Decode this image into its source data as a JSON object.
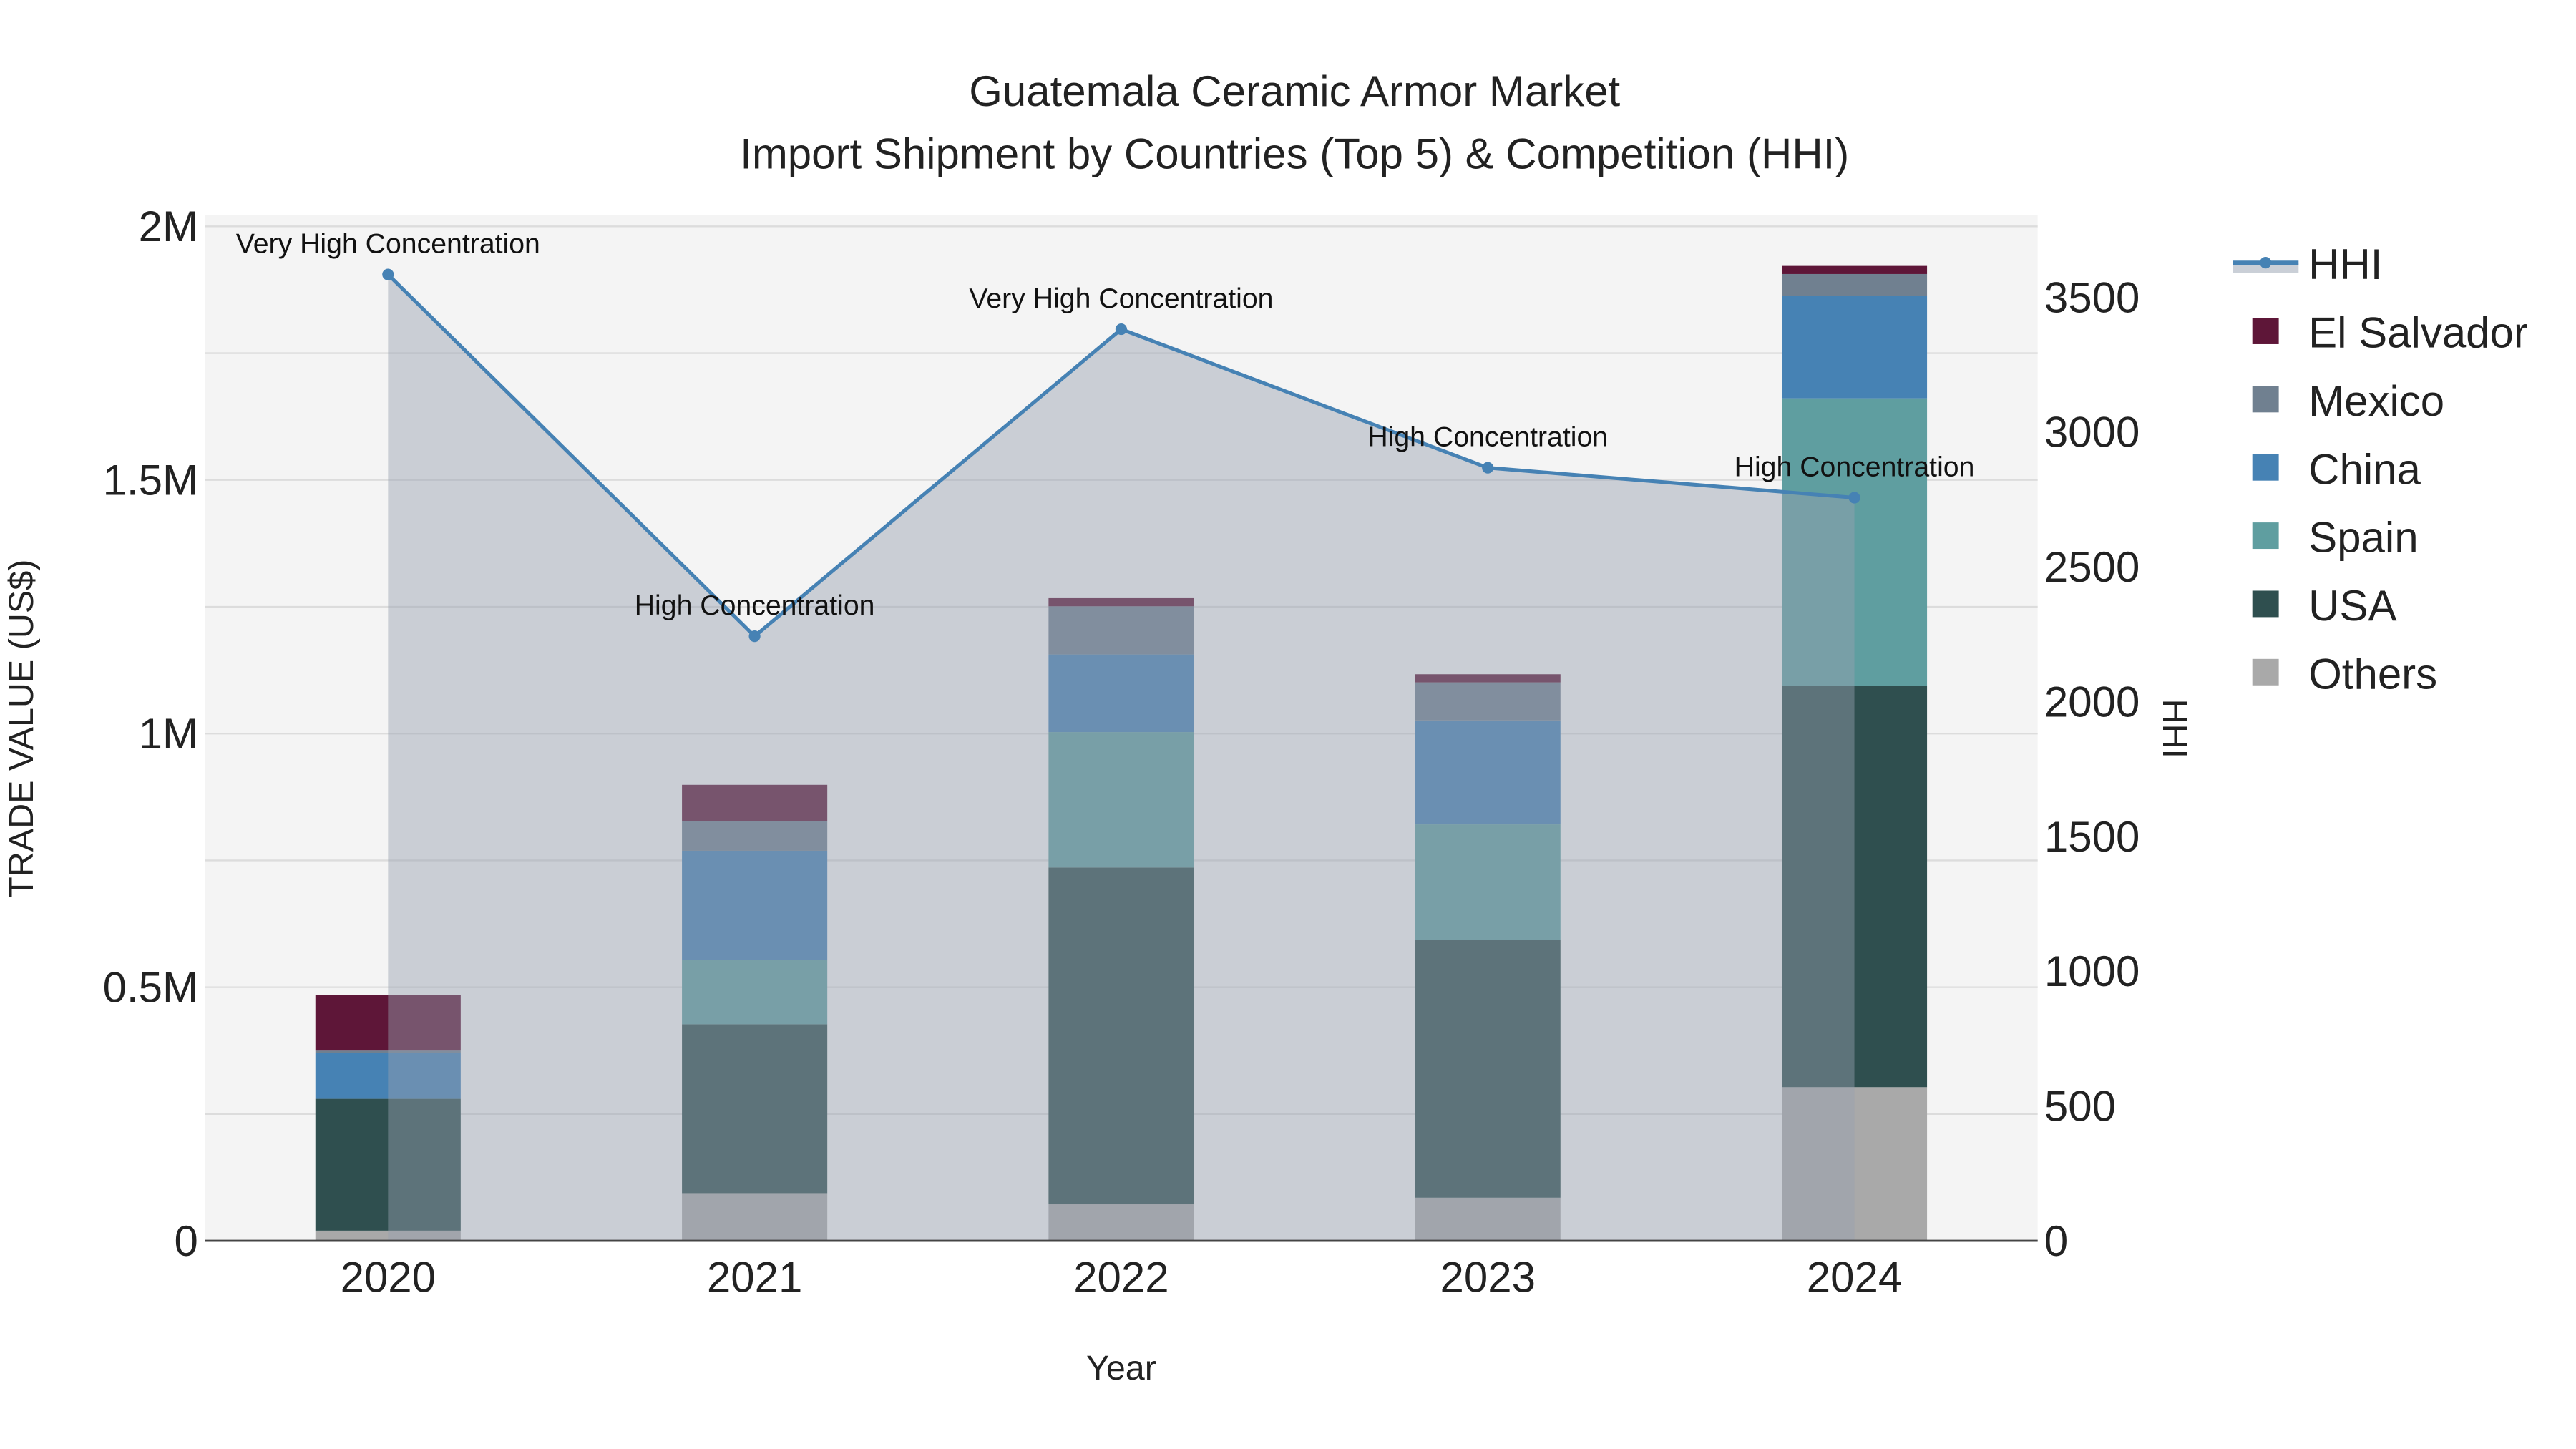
{
  "chart_data": {
    "type": "bar",
    "title": "Guatemala Ceramic Armor Market",
    "subtitle": "Import Shipment by Countries (Top 5) & Competition (HHI)",
    "xlabel": "Year",
    "ylabel": "TRADE VALUE (US$)",
    "y2label": "HHI",
    "categories": [
      "2020",
      "2021",
      "2022",
      "2023",
      "2024"
    ],
    "ylim": [
      0,
      2000000
    ],
    "y2lim": [
      0,
      3800
    ],
    "yticks": [
      {
        "v": 0,
        "label": "0"
      },
      {
        "v": 500000,
        "label": "0.5M"
      },
      {
        "v": 1000000,
        "label": "1M"
      },
      {
        "v": 1500000,
        "label": "1.5M"
      },
      {
        "v": 2000000,
        "label": "2M"
      }
    ],
    "y2ticks": [
      {
        "v": 0,
        "label": "0"
      },
      {
        "v": 500,
        "label": "500"
      },
      {
        "v": 1000,
        "label": "1000"
      },
      {
        "v": 1500,
        "label": "1500"
      },
      {
        "v": 2000,
        "label": "2000"
      },
      {
        "v": 2500,
        "label": "2500"
      },
      {
        "v": 3000,
        "label": "3000"
      },
      {
        "v": 3500,
        "label": "3500"
      }
    ],
    "stacked": true,
    "series": [
      {
        "name": "Others",
        "color": "#a9a9a9",
        "values": [
          20000,
          94000,
          72000,
          85000,
          303000
        ]
      },
      {
        "name": "USA",
        "color": "#2f4f4f",
        "values": [
          260000,
          333000,
          664000,
          508000,
          791000
        ]
      },
      {
        "name": "Spain",
        "color": "#5f9ea0",
        "values": [
          0,
          127000,
          267000,
          228000,
          567000
        ]
      },
      {
        "name": "China",
        "color": "#4682b4",
        "values": [
          90000,
          215000,
          153000,
          205000,
          202000
        ]
      },
      {
        "name": "Mexico",
        "color": "#708090",
        "values": [
          5000,
          58000,
          95000,
          75000,
          43000
        ]
      },
      {
        "name": "El Salvador",
        "color": "#5e1638",
        "values": [
          110000,
          72000,
          16000,
          16000,
          16000
        ]
      }
    ],
    "hhi": {
      "name": "HHI",
      "color": "#4682b4",
      "values": [
        3585,
        2243,
        3382,
        2868,
        2757
      ],
      "annotations": [
        "Very High Concentration",
        "High Concentration",
        "Very High Concentration",
        "High Concentration",
        "High Concentration"
      ]
    },
    "legend_order": [
      "HHI",
      "El Salvador",
      "Mexico",
      "China",
      "Spain",
      "USA",
      "Others"
    ],
    "legend_position": "right",
    "grid": true
  }
}
